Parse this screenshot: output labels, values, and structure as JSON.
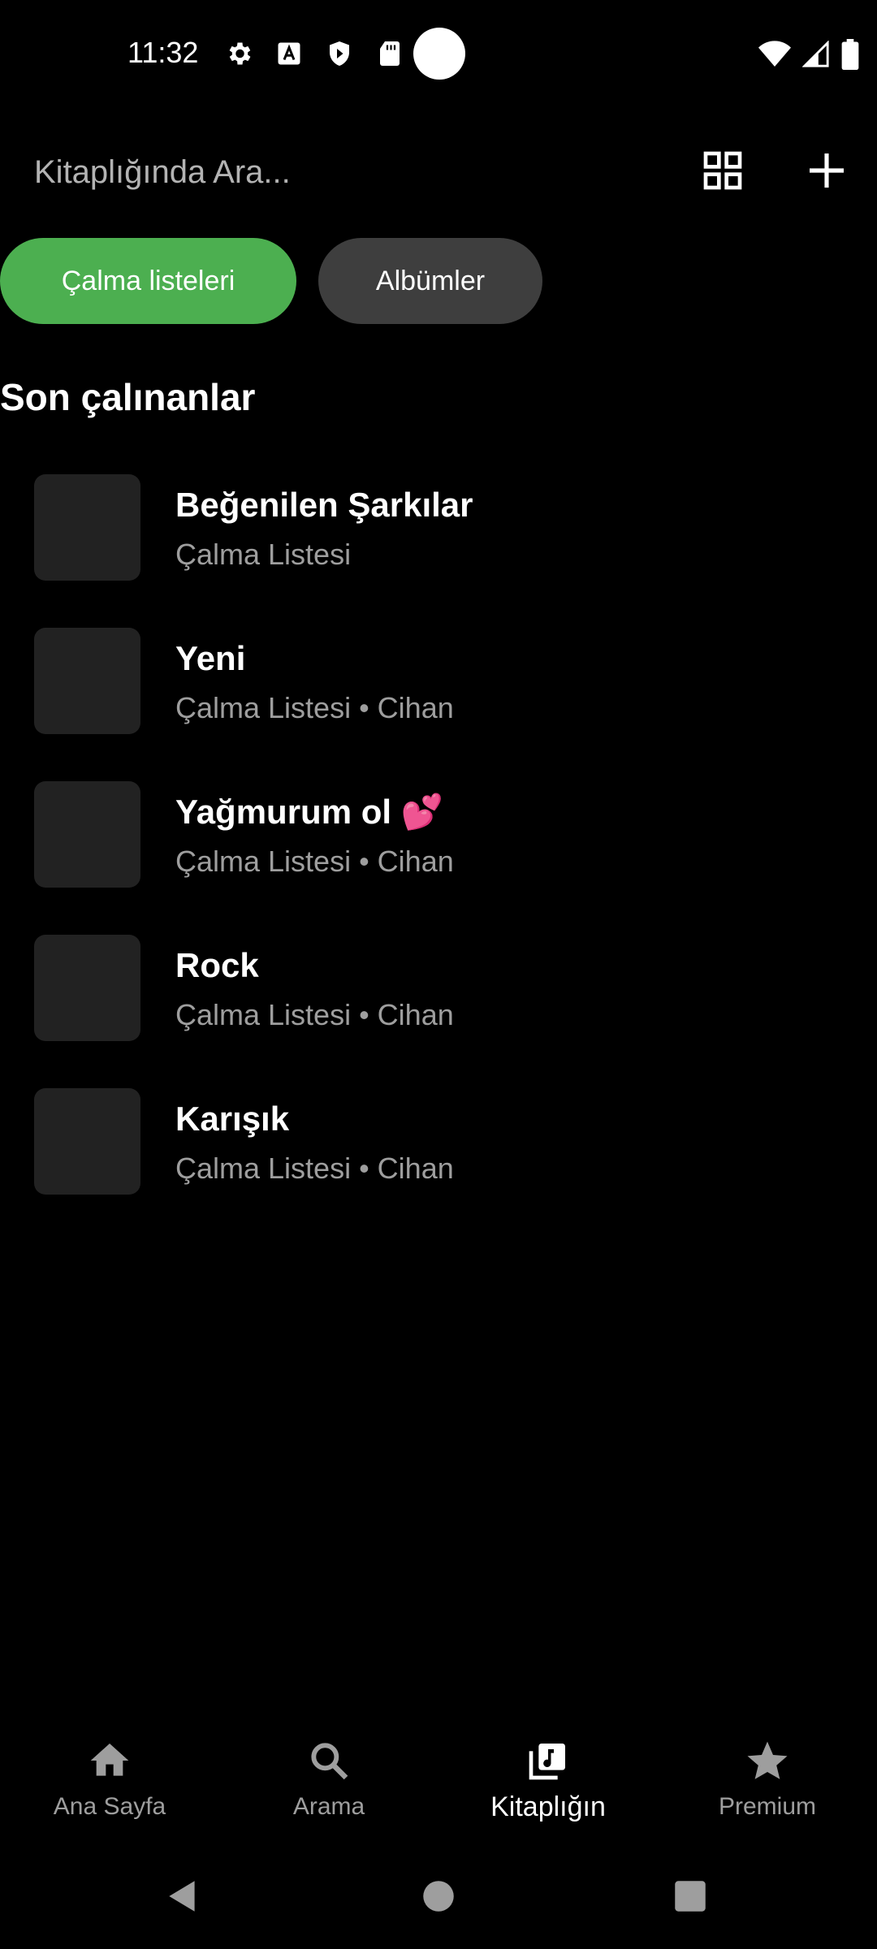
{
  "status": {
    "time": "11:32"
  },
  "search": {
    "placeholder": "Kitaplığında Ara..."
  },
  "chips": {
    "playlists": "Çalma listeleri",
    "albums": "Albümler"
  },
  "section": {
    "title": "Son çalınanlar"
  },
  "items": [
    {
      "title": "Beğenilen Şarkılar",
      "subtitle": "Çalma Listesi"
    },
    {
      "title": "Yeni",
      "subtitle": "Çalma Listesi • Cihan"
    },
    {
      "title": "Yağmurum ol 💕",
      "subtitle": "Çalma Listesi • Cihan"
    },
    {
      "title": "Rock",
      "subtitle": "Çalma Listesi • Cihan"
    },
    {
      "title": "Karışık",
      "subtitle": "Çalma Listesi • Cihan"
    }
  ],
  "nav": {
    "home": "Ana Sayfa",
    "search": "Arama",
    "library": "Kitaplığın",
    "premium": "Premium"
  },
  "colors": {
    "accent": "#4caf50",
    "chip_inactive": "#3e3e3e",
    "background": "#000000"
  }
}
